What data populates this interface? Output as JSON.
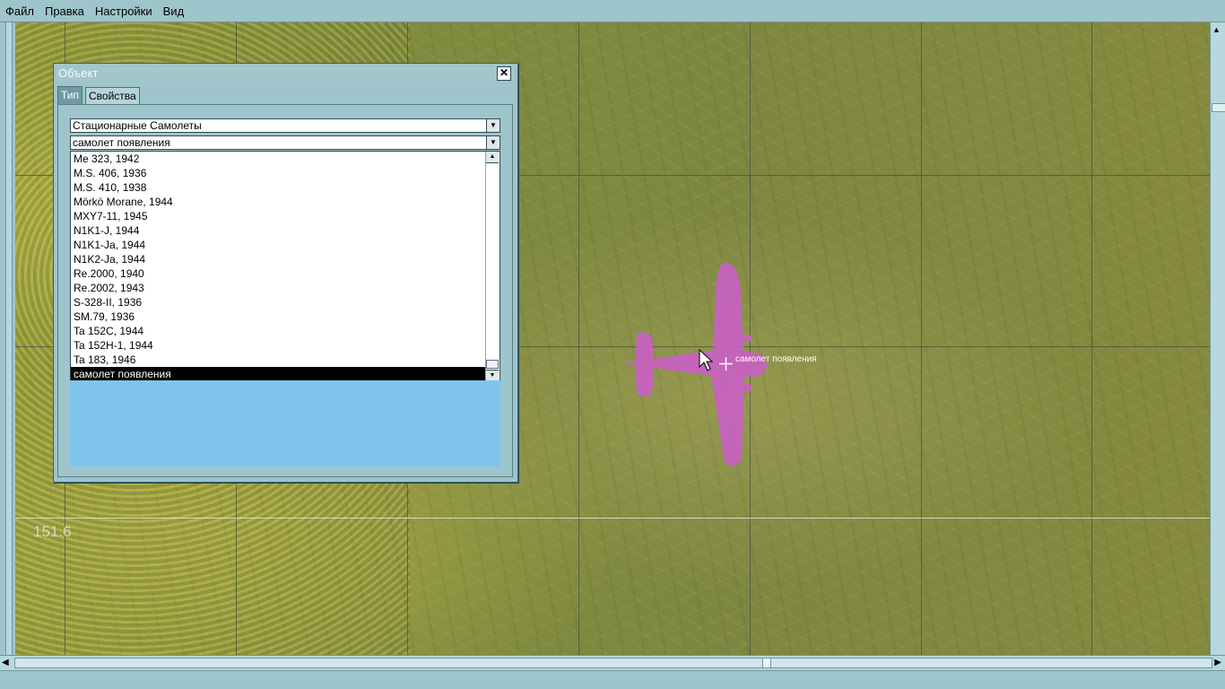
{
  "menu": [
    "Файл",
    "Правка",
    "Настройки",
    "Вид"
  ],
  "map": {
    "scale_label": "151.6",
    "object_label": "самолет появления",
    "plane_color": "#c861c3"
  },
  "dialog": {
    "title": "Объект",
    "close_symbol": "✕",
    "tabs": [
      "Тип",
      "Свойства"
    ],
    "active_tab": "Тип",
    "category": "Стационарные Самолеты",
    "object": "самолет появления",
    "list_items": [
      "Me 323, 1942",
      "M.S. 406, 1936",
      "M.S. 410, 1938",
      "Mörkö Morane, 1944",
      "MXY7-11, 1945",
      "N1K1-J, 1944",
      "N1K1-Ja, 1944",
      "N1K2-Ja, 1944",
      "Re.2000, 1940",
      "Re.2002, 1943",
      "S-328-II, 1936",
      "SM.79, 1936",
      "Ta 152C, 1944",
      "Ta 152H-1, 1944",
      "Ta 183, 1946",
      "самолет появления"
    ],
    "selected_item": "самолет появления",
    "preview_color": "#7fc4ec"
  }
}
